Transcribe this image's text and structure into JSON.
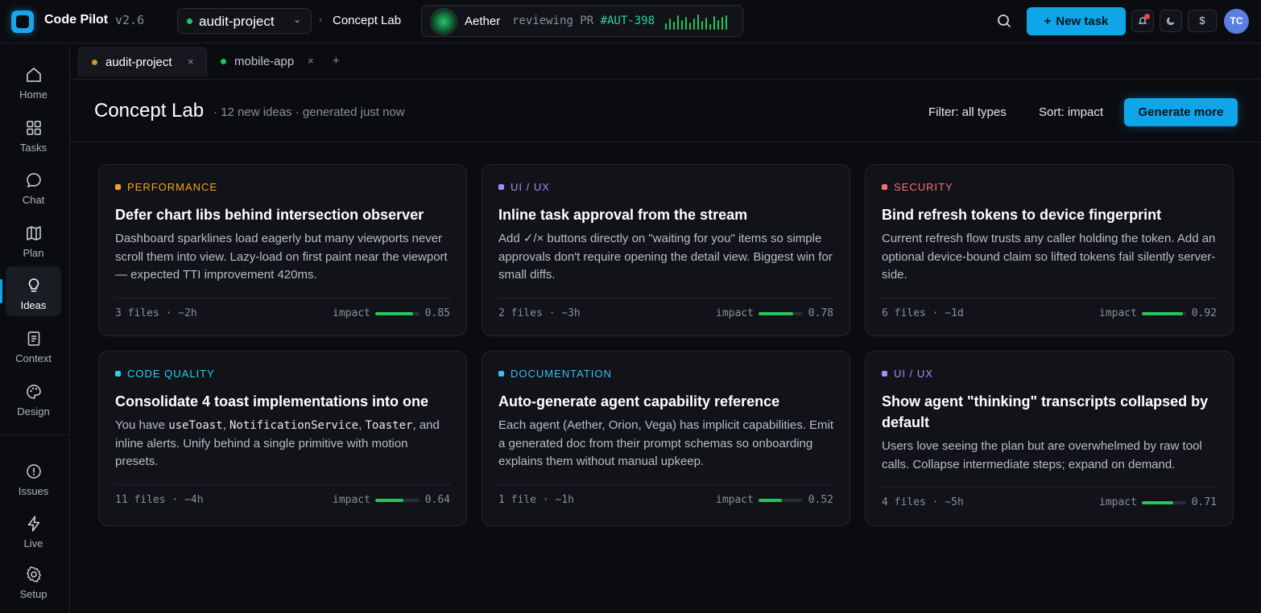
{
  "app": {
    "name": "Code Pilot",
    "version": "v2.6"
  },
  "topbar": {
    "project": "audit-project",
    "breadcrumb": "Concept Lab",
    "agent": {
      "name": "Aether",
      "status_prefix": "reviewing PR ",
      "status_ref": "#AUT-398"
    },
    "new_task_label": "New task",
    "avatar_initials": "TC",
    "currency_symbol": "$"
  },
  "sidebar": {
    "items": [
      {
        "label": "Home",
        "icon": "home-icon"
      },
      {
        "label": "Tasks",
        "icon": "grid-icon"
      },
      {
        "label": "Chat",
        "icon": "chat-icon"
      },
      {
        "label": "Plan",
        "icon": "map-icon"
      },
      {
        "label": "Ideas",
        "icon": "lightbulb-icon",
        "active": true
      },
      {
        "label": "Context",
        "icon": "document-icon"
      },
      {
        "label": "Design",
        "icon": "palette-icon"
      }
    ],
    "bottom_items": [
      {
        "label": "Issues",
        "icon": "alert-circle-icon"
      },
      {
        "label": "Live",
        "icon": "bolt-icon"
      },
      {
        "label": "Setup",
        "icon": "gear-icon"
      }
    ]
  },
  "tabs": [
    {
      "label": "audit-project",
      "dot_color": "#c9953a",
      "active": true
    },
    {
      "label": "mobile-app",
      "dot_color": "#22c55e",
      "active": false
    }
  ],
  "page": {
    "title": "Concept Lab",
    "subtitle": "· 12 new ideas · generated just now",
    "filter_label": "Filter: all types",
    "sort_label": "Sort: impact",
    "generate_label": "Generate more"
  },
  "impact_label": "impact",
  "ideas": [
    {
      "category": "PERFORMANCE",
      "color": "#f5a524",
      "title": "Defer chart libs behind intersection observer",
      "desc": "Dashboard sparklines load eagerly but many viewports never scroll them into view. Lazy-load on first paint near the viewport — expected TTI improvement 420ms.",
      "meta": "3 files · ~2h",
      "impact": 0.85,
      "impact_text": "0.85"
    },
    {
      "category": "UI / UX",
      "color": "#a78bfa",
      "title": "Inline task approval from the stream",
      "desc": "Add ✓/× buttons directly on \"waiting for you\" items so simple approvals don't require opening the detail view. Biggest win for small diffs.",
      "meta": "2 files · ~3h",
      "impact": 0.78,
      "impact_text": "0.78"
    },
    {
      "category": "SECURITY",
      "color": "#f87171",
      "title": "Bind refresh tokens to device fingerprint",
      "desc": "Current refresh flow trusts any caller holding the token. Add an optional device-bound claim so lifted tokens fail silently server-side.",
      "meta": "6 files · ~1d",
      "impact": 0.92,
      "impact_text": "0.92"
    },
    {
      "category": "CODE QUALITY",
      "color": "#22d3ee",
      "title": "Consolidate 4 toast implementations into one",
      "desc_parts": [
        "You have ",
        "useToast",
        ", ",
        "NotificationService",
        ", ",
        "Toaster",
        ", and inline alerts. Unify behind a single primitive with motion presets."
      ],
      "meta": "11 files · ~4h",
      "impact": 0.64,
      "impact_text": "0.64"
    },
    {
      "category": "DOCUMENTATION",
      "color": "#38bdf8",
      "title": "Auto-generate agent capability reference",
      "desc": "Each agent (Aether, Orion, Vega) has implicit capabilities. Emit a generated doc from their prompt schemas so onboarding explains them without manual upkeep.",
      "meta": "1 file · ~1h",
      "impact": 0.52,
      "impact_text": "0.52"
    },
    {
      "category": "UI / UX",
      "color": "#a78bfa",
      "title": "Show agent \"thinking\" transcripts collapsed by default",
      "desc": "Users love seeing the plan but are overwhelmed by raw tool calls. Collapse intermediate steps; expand on demand.",
      "meta": "4 files · ~5h",
      "impact": 0.71,
      "impact_text": "0.71"
    }
  ]
}
